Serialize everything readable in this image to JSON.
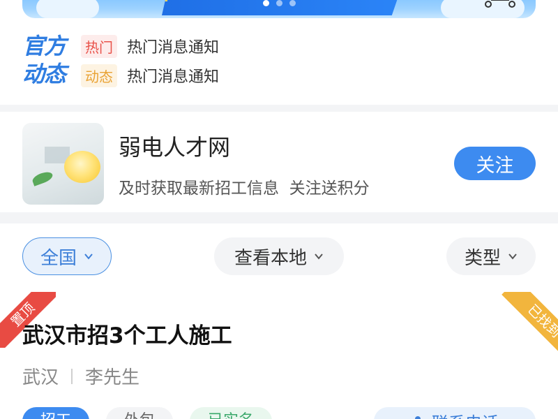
{
  "banner": {
    "dots": 3,
    "active_dot": 1
  },
  "official_news": {
    "logo_line1": "官方",
    "logo_line2": "动态",
    "items": [
      {
        "tag": "热门",
        "text": "热门消息通知"
      },
      {
        "tag": "动态",
        "text": "热门消息通知"
      }
    ]
  },
  "recruiter": {
    "name": "弱电人才网",
    "subtitle": "及时获取最新招工信息  关注送积分",
    "follow_label": "关注"
  },
  "filters": {
    "region": "全国",
    "local": "查看本地",
    "type": "类型"
  },
  "job": {
    "pin_label": "置顶",
    "status_label": "已找到",
    "title": "武汉市招3个工人施工",
    "city": "武汉",
    "contact_name": "李先生",
    "tags": [
      "招工",
      "外包",
      "已实名"
    ],
    "contact_button": "联系电话"
  },
  "colors": {
    "accent": "#3d8bf0",
    "hot": "#e9524a",
    "dynamic": "#e9a233",
    "pin": "#e84b43",
    "found": "#f2b53d"
  }
}
